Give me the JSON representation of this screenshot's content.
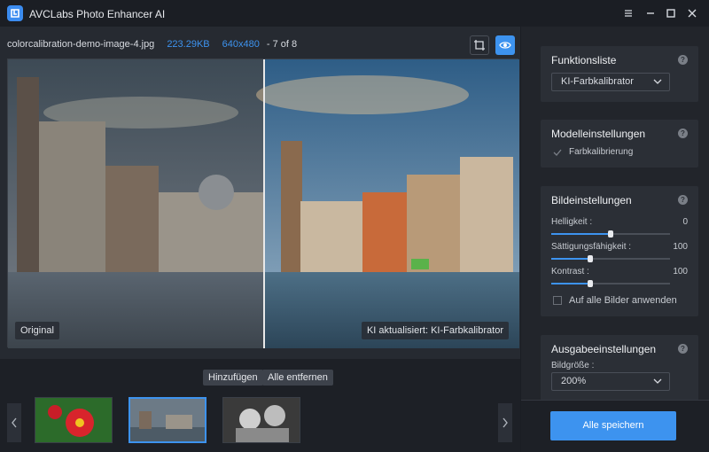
{
  "app": {
    "title": "AVCLabs Photo Enhancer AI"
  },
  "file": {
    "name": "colorcalibration-demo-image-4.jpg",
    "size": "223.29KB",
    "dimensions": "640x480",
    "position": "- 7 of 8"
  },
  "preview": {
    "original_label": "Original",
    "ai_label": "KI aktualisiert: KI-Farbkalibrator",
    "split": 0.5
  },
  "thumbs": {
    "add_label": "Hinzufügen",
    "remove_all_label": "Alle entfernen",
    "selected_index": 1
  },
  "panels": {
    "functions": {
      "title": "Funktionsliste",
      "selected": "KI-Farbkalibrator"
    },
    "model": {
      "title": "Modelleinstellungen",
      "option": "Farbkalibrierung"
    },
    "image": {
      "title": "Bildeinstellungen",
      "brightness": {
        "label": "Helligkeit :",
        "value": "0",
        "fraction": 0.5
      },
      "saturation": {
        "label": "Sättigungsfähigkeit :",
        "value": "100",
        "fraction": 0.33
      },
      "contrast": {
        "label": "Kontrast :",
        "value": "100",
        "fraction": 0.33
      },
      "apply_all": "Auf alle Bilder anwenden"
    },
    "output": {
      "title": "Ausgabeeinstellungen",
      "size_label": "Bildgröße :",
      "size_value": "200%"
    }
  },
  "save": {
    "label": "Alle speichern"
  },
  "colors": {
    "accent": "#3d93ef",
    "bg": "#1b1e24",
    "panel": "#2b2f36"
  }
}
